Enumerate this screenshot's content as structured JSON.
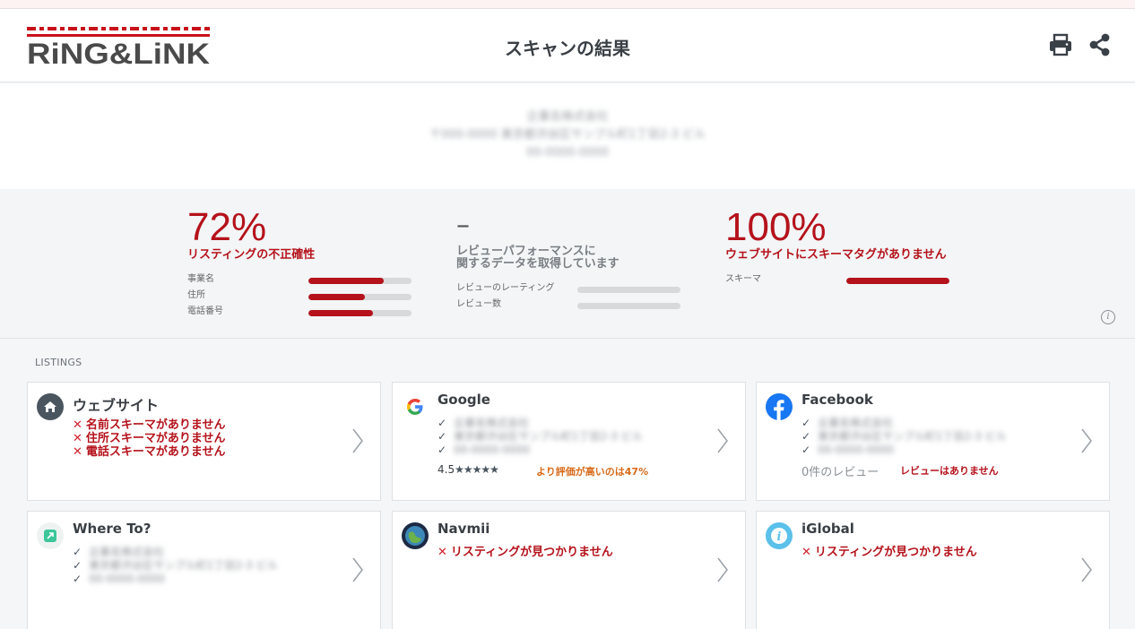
{
  "header": {
    "logo_text": "RiNG&LiNK",
    "title": "スキャンの結果",
    "print_icon": "print-icon",
    "share_icon": "share-icon"
  },
  "business": {
    "name": "企業名株式会社",
    "address": "〒000-0000 東京都渋谷区サンプル町1丁目2-3 ビル",
    "phone": "00-0000-0000"
  },
  "metrics": {
    "listing": {
      "percent": "72%",
      "label": "リスティングの不正確性",
      "bars": [
        {
          "label": "事業名",
          "value": 0.73
        },
        {
          "label": "住所",
          "value": 0.55
        },
        {
          "label": "電話番号",
          "value": 0.63
        }
      ]
    },
    "review": {
      "value": "–",
      "label": "レビューパフォーマンスに\n関するデータを取得しています",
      "bars": [
        {
          "label": "レビューのレーティング",
          "value": 0
        },
        {
          "label": "レビュー数",
          "value": 0
        }
      ]
    },
    "schema": {
      "percent": "100%",
      "label": "ウェブサイトにスキーマタグがありません",
      "bars": [
        {
          "label": "スキーマ",
          "value": 1.0
        }
      ]
    }
  },
  "listings_label": "LISTINGS",
  "cards": {
    "website": {
      "title": "ウェブサイト",
      "errors": [
        "名前スキーマがありません",
        "住所スキーマがありません",
        "電話スキーマがありません"
      ]
    },
    "google": {
      "title": "Google",
      "checks": [
        "企業名株式会社",
        "東京都渋谷区サンプル町1丁目2-3 ビル",
        "00-0000-0000"
      ],
      "rating": "4.5",
      "stars": "★★★★★",
      "note": "より評価が高いのは47%"
    },
    "facebook": {
      "title": "Facebook",
      "checks": [
        "企業名株式会社",
        "東京都渋谷区サンプル町1丁目2-3 ビル",
        "00-0000-0000"
      ],
      "reviews": "0件のレビュー",
      "no_reviews": "レビューはありません"
    },
    "whereto": {
      "title": "Where To?",
      "checks": [
        "企業名株式会社",
        "東京都渋谷区サンプル町1丁目2-3 ビル",
        "00-0000-0000"
      ]
    },
    "navmii": {
      "title": "Navmii",
      "error": "リスティングが見つかりません"
    },
    "iglobal": {
      "title": "iGlobal",
      "error": "リスティングが見つかりません"
    }
  },
  "colors": {
    "accent_red": "#b5121b",
    "rating_orange": "#d86b1a"
  }
}
